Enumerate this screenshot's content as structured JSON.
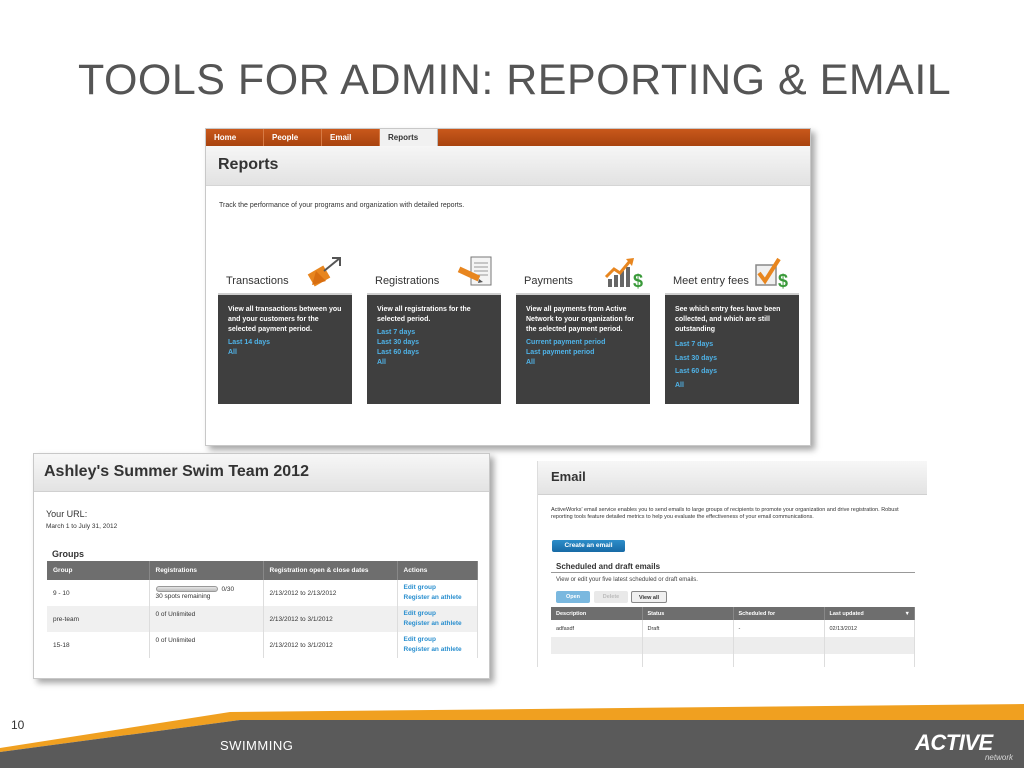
{
  "slide": {
    "title": "TOOLS FOR ADMIN: REPORTING & EMAIL",
    "number": "10",
    "footer_label": "SWIMMING",
    "logo_text": "ACTIVE",
    "logo_sub": "network",
    "colors": {
      "footer_gray": "#5a5a5a",
      "footer_orange": "#f0a020",
      "title": "#555555"
    }
  },
  "reports": {
    "nav": [
      "Home",
      "People",
      "Email",
      "Reports"
    ],
    "active_tab": "Reports",
    "title": "Reports",
    "description": "Track the performance of your programs and organization with detailed reports.",
    "cards": [
      {
        "title": "Transactions",
        "icon": "arrows-icon",
        "description": "View all transactions between you and your customers for the selected payment period.",
        "links": [
          "Last 14 days",
          "All"
        ]
      },
      {
        "title": "Registrations",
        "icon": "document-pencil-icon",
        "description": "View all registrations for the selected period.",
        "links": [
          "Last 7 days",
          "Last 30 days",
          "Last 60 days",
          "All"
        ]
      },
      {
        "title": "Payments",
        "icon": "growth-chart-dollar-icon",
        "description": "View all payments from Active Network to your organization for the selected payment period.",
        "links": [
          "Current payment period",
          "Last payment period",
          "All"
        ]
      },
      {
        "title": "Meet entry fees",
        "icon": "checkmark-dollar-icon",
        "description": "See which entry fees have been collected, and which are still outstanding",
        "links": [
          "Last 7 days",
          "Last 30 days",
          "Last 60 days",
          "All"
        ]
      }
    ],
    "colors": {
      "nav_orange": "#b84c14",
      "card_dark": "#3f3f3f",
      "link_blue": "#4fb3e8"
    }
  },
  "swim": {
    "title": "Ashley's Summer Swim Team 2012",
    "url_label": "Your URL:",
    "date_range": "March 1 to July 31, 2012",
    "groups_label": "Groups",
    "columns": [
      "Group",
      "Registrations",
      "Registration open & close dates",
      "Actions"
    ],
    "rows": [
      {
        "group": "9 - 10",
        "registrations": "0/30",
        "spots": "30 spots remaining",
        "progress": 0,
        "dates": "2/13/2012 to 2/13/2012",
        "actions": [
          "Edit group",
          "Register an athlete"
        ]
      },
      {
        "group": "pre-team",
        "registrations": "0 of Unlimited",
        "dates": "2/13/2012 to 3/1/2012",
        "actions": [
          "Edit group",
          "Register an athlete"
        ]
      },
      {
        "group": "15-18",
        "registrations": "0 of Unlimited",
        "dates": "2/13/2012 to 3/1/2012",
        "actions": [
          "Edit group",
          "Register an athlete"
        ]
      }
    ]
  },
  "email": {
    "title": "Email",
    "description": "ActiveWorks' email service enables you to send emails to large groups of recipients to promote your organization and drive registration. Robust reporting tools feature detailed metrics to help you evaluate the effectiveness of your email communications.",
    "create_button": "Create an email",
    "scheduled_title": "Scheduled and draft emails",
    "scheduled_sub": "View or edit your five latest scheduled or draft emails.",
    "buttons": {
      "open": "Open",
      "delete": "Delete",
      "view_all": "View all"
    },
    "columns": [
      "Description",
      "Status",
      "Scheduled for",
      "Last updated"
    ],
    "rows": [
      {
        "description": "adfasdf",
        "status": "Draft",
        "scheduled": "-",
        "updated": "02/13/2012"
      }
    ]
  }
}
